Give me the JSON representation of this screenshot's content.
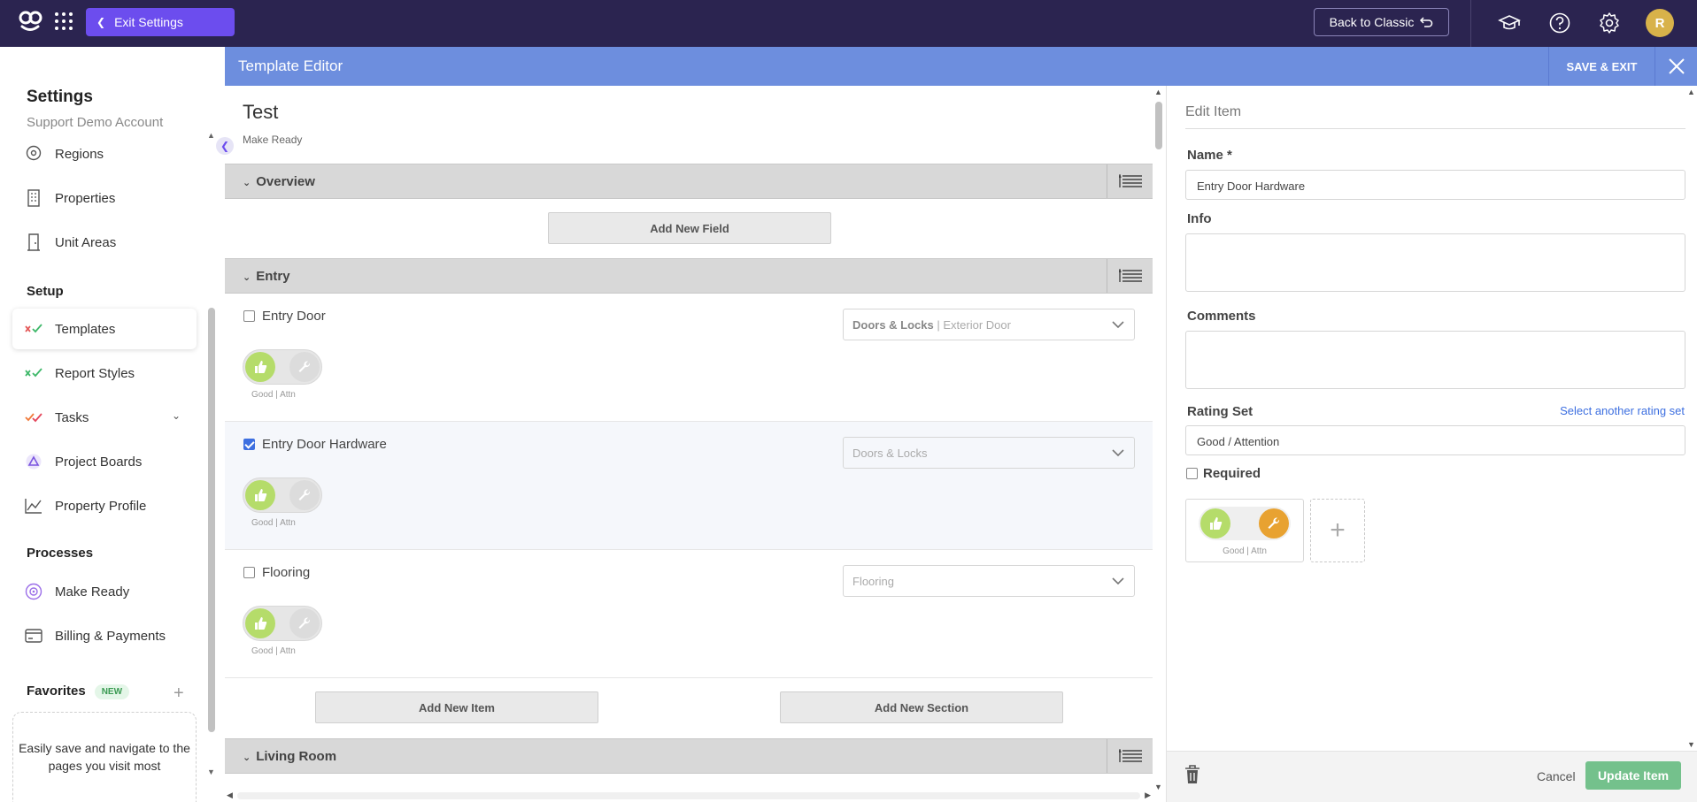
{
  "topbar": {
    "exit_settings_label": "Exit Settings",
    "back_to_classic_label": "Back to Classic",
    "avatar_initial": "R",
    "icons": [
      "logo-icon",
      "apps-grid-icon",
      "graduation-cap-icon",
      "help-icon",
      "gear-icon"
    ]
  },
  "sidebar": {
    "title": "Settings",
    "account": "Support Demo Account",
    "top_items": [
      {
        "label": "Regions",
        "icon": "map-pin-icon"
      },
      {
        "label": "Properties",
        "icon": "building-icon"
      },
      {
        "label": "Unit Areas",
        "icon": "door-icon"
      }
    ],
    "setup_heading": "Setup",
    "setup_items": [
      {
        "label": "Templates",
        "icon": "check-x-icon",
        "active": true
      },
      {
        "label": "Report Styles",
        "icon": "check-x-icon"
      },
      {
        "label": "Tasks",
        "icon": "tasks-icon",
        "expandable": true
      },
      {
        "label": "Project Boards",
        "icon": "triangle-icon"
      },
      {
        "label": "Property Profile",
        "icon": "chart-line-icon"
      }
    ],
    "processes_heading": "Processes",
    "process_items": [
      {
        "label": "Make Ready",
        "icon": "target-icon"
      },
      {
        "label": "Billing & Payments",
        "icon": "credit-card-icon"
      }
    ],
    "favorites_heading": "Favorites",
    "favorites_badge": "NEW",
    "favorites_empty_text": "Easily save and navigate to the pages you visit most"
  },
  "editor": {
    "header_title": "Template Editor",
    "save_exit_label": "SAVE & EXIT",
    "template_name": "Test",
    "template_type": "Make Ready",
    "add_field_label": "Add New Field",
    "add_item_label": "Add New Item",
    "add_section_label": "Add New Section",
    "sections": [
      {
        "name": "Overview"
      },
      {
        "name": "Entry"
      },
      {
        "name": "Living Room"
      }
    ],
    "items": [
      {
        "name": "Entry Door",
        "checked": false,
        "category": "Doors & Locks",
        "subcategory": "Exterior Door",
        "rating_caption": "Good | Attn"
      },
      {
        "name": "Entry Door Hardware",
        "checked": true,
        "category": "Doors & Locks",
        "subcategory": "",
        "rating_caption": "Good | Attn"
      },
      {
        "name": "Flooring",
        "checked": false,
        "category": "Flooring",
        "subcategory": "",
        "rating_caption": "Good | Attn"
      }
    ]
  },
  "edit_item": {
    "title": "Edit Item",
    "name_label": "Name *",
    "name_value": "Entry Door Hardware",
    "info_label": "Info",
    "comments_label": "Comments",
    "rating_set_label": "Rating Set",
    "select_rating_link": "Select another rating set",
    "rating_set_value": "Good / Attention",
    "required_label": "Required",
    "rating_caption": "Good | Attn",
    "cancel_label": "Cancel",
    "update_label": "Update Item"
  }
}
